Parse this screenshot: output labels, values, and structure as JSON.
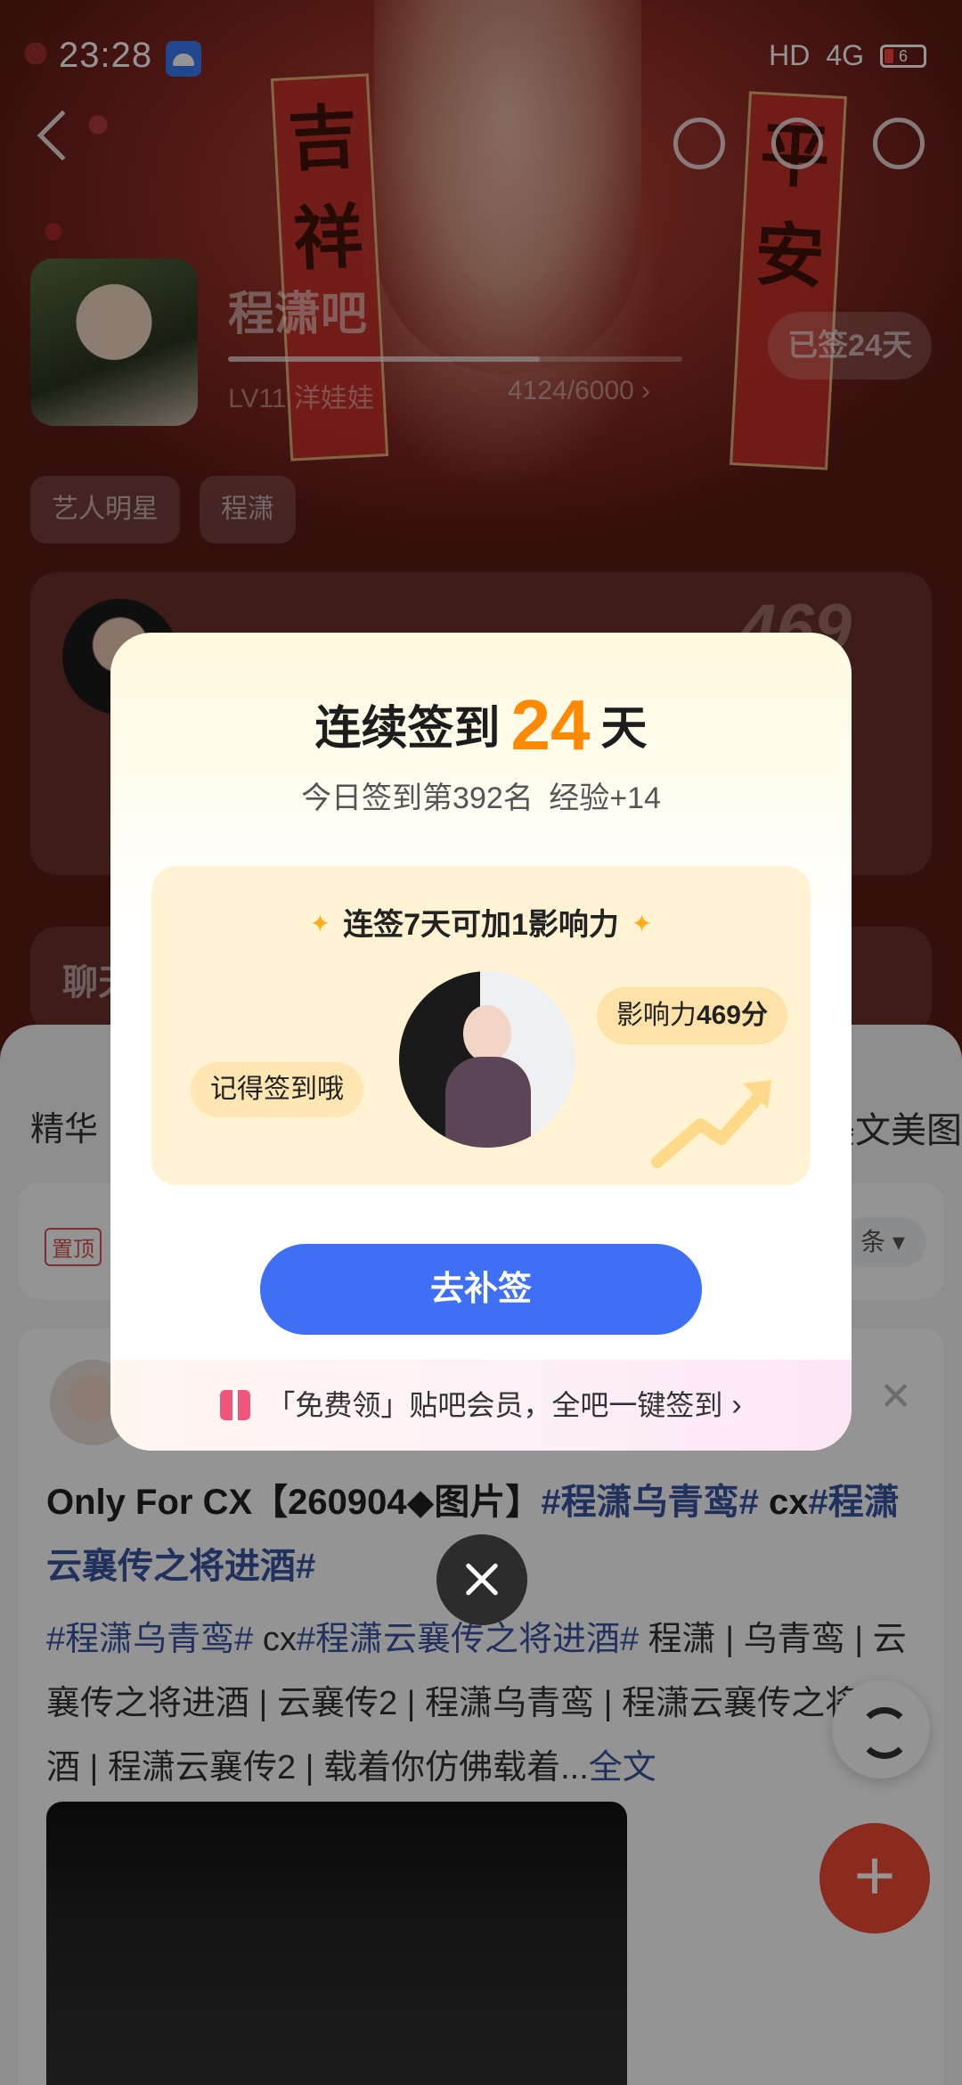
{
  "status_bar": {
    "time": "23:28",
    "network": "HD",
    "signal": "4G",
    "battery": "6"
  },
  "forum": {
    "name": "程潇吧",
    "level": "LV11 洋娃娃",
    "exp": "4124/6000",
    "exp_progress": 0.687,
    "signed_days_label": "已签24天",
    "tags": [
      "艺人明星",
      "程潇"
    ]
  },
  "star_card": {
    "score": "469"
  },
  "chat_card": {
    "label": "聊天"
  },
  "feed": {
    "tab_left": "精华",
    "tab_right": "美文美图",
    "pin_label": "置顶",
    "sort_label": "条",
    "post": {
      "title_plain": "Only For CX【260904◆图片】",
      "title_tag1": "#程潇乌青鸾#",
      "title_mid": " cx",
      "title_tag2": "#程潇云襄传之将进酒#",
      "body_tag1": "#程潇乌青鸾#",
      "body_mid": " cx",
      "body_tag2": "#程潇云襄传之将进酒#",
      "body_text": " 程潇 | 乌青鸾 | 云襄传之将进酒 | 云襄传2 | 程潇乌青鸾 | 程潇云襄传之将进酒 | 程潇云襄传2 | 载着你仿佛载着...",
      "body_more": "全文"
    }
  },
  "dialog": {
    "title_prefix": "连续签到",
    "streak_days": "24",
    "title_suffix": "天",
    "subtitle_rank": "今日签到第392名",
    "subtitle_exp": "经验+14",
    "reward_headline": "连签7天可加1影响力",
    "bubble_left": "记得签到哦",
    "bubble_right_label": "影响力",
    "bubble_right_value": "469分",
    "makeup_button": "去补签",
    "promo_text": "「免费领」贴吧会员，全吧一键签到",
    "colors": {
      "accent_orange": "#ff8a00",
      "button_blue": "#3e6ff5"
    }
  }
}
